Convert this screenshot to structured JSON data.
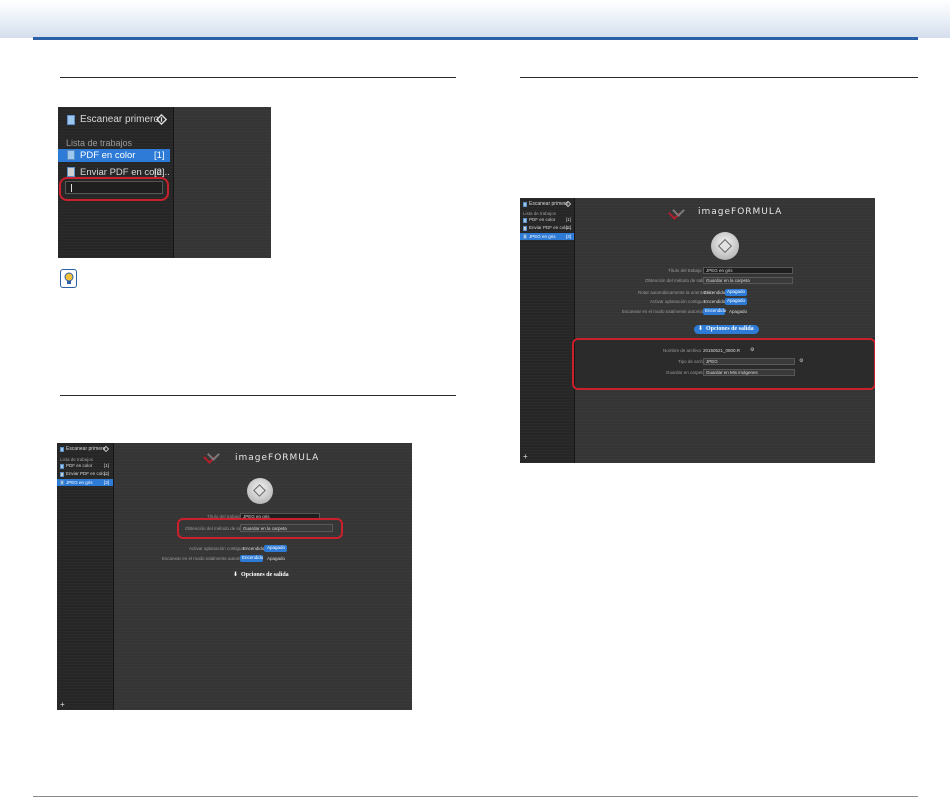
{
  "shot1": {
    "title": "Escanear primero",
    "list_label": "Lista de trabajos",
    "jobs": [
      {
        "label": "PDF en color",
        "count": "[1]"
      },
      {
        "label": "Enviar PDF en colo...",
        "count": "[2]"
      }
    ],
    "new_job_value": ""
  },
  "shot2": {
    "sidebar_title": "Escanear primero",
    "list_label": "Lista de trabajos",
    "jobs": [
      {
        "label": "PDF en color",
        "count": "[1]"
      },
      {
        "label": "Enviar PDF en colo...",
        "count": "[2]"
      },
      {
        "label": "JPEG en gris",
        "count": "[3]"
      }
    ],
    "logo": "imageFORMULA",
    "fields": {
      "title_label": "Título del trabajo",
      "title_value": "JPEG en gris",
      "method_label": "Obtención del método de salida",
      "method_value": "Guardar en la carpeta",
      "autocrop_label": "Activar aplanación contigua",
      "autocrop_on": "Encendido",
      "autocrop_off": "Apagado",
      "auto_label": "Escanear en el modo totalmente automático",
      "auto_on": "Encendido",
      "auto_off": "Apagado"
    },
    "output_button": "Opciones de salida",
    "add_icon": "+"
  },
  "shot3": {
    "sidebar_title": "Escanear primero",
    "list_label": "Lista de trabajos",
    "jobs": [
      {
        "label": "PDF en color",
        "count": "[1]"
      },
      {
        "label": "Enviar PDF en colo...",
        "count": "[2]"
      },
      {
        "label": "JPEG en gris",
        "count": "[3]"
      }
    ],
    "logo": "imageFORMULA",
    "fields": {
      "title_label": "Título del trabajo",
      "title_value": "JPEG en gris",
      "method_label": "Obtención del método de salida",
      "method_value": "Guardar en la carpeta",
      "rotate_label": "Rotar automáticamente la orientación",
      "rotate_on": "Encendido",
      "rotate_off": "Apagado",
      "autocrop_label": "Activar aplanación contigua",
      "autocrop_on": "Encendido",
      "autocrop_off": "Apagado",
      "auto_label": "Escanear en el modo totalmente automático",
      "auto_on": "Encendido",
      "auto_off": "Apagado"
    },
    "output_button": "Opciones de salida",
    "output": {
      "filename_label": "Nombre de archivo",
      "filename_value": "20150521_0800.R",
      "filetype_label": "Tipo de archivo",
      "filetype_value": "JPEG",
      "save_label": "Guardar en carpeta",
      "save_value": "Guardar en Mis imágenes"
    },
    "add_icon": "+"
  },
  "colors": {
    "accent": "#2d7bd6",
    "highlight": "#c8202d",
    "rule": "#2b5fa6"
  }
}
